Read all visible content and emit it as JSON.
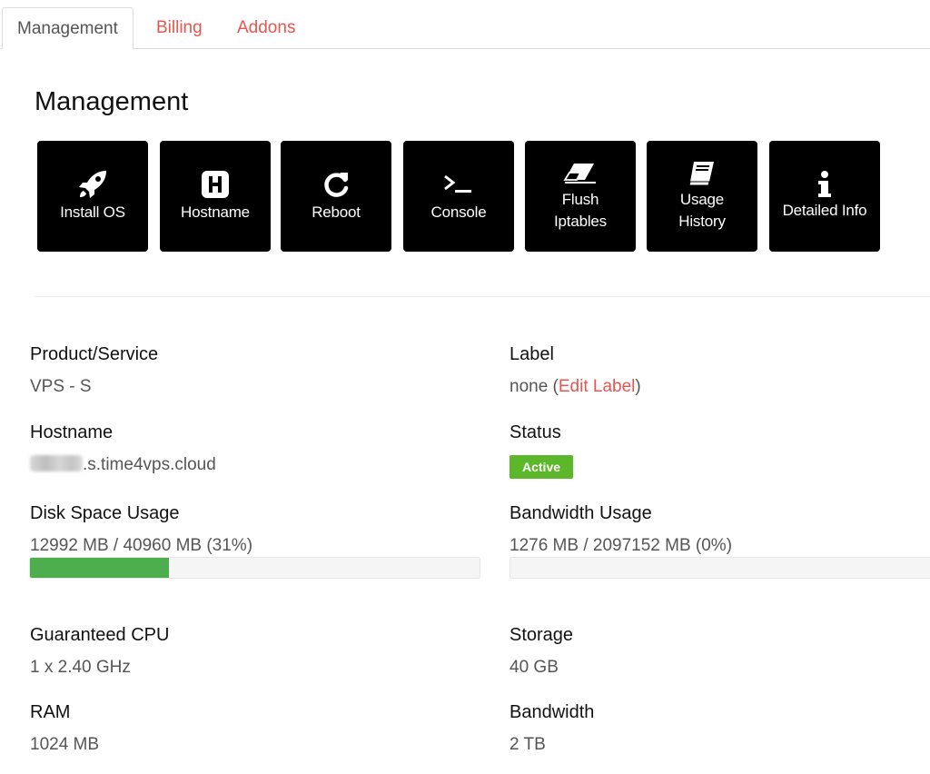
{
  "tabs": [
    {
      "label": "Management",
      "active": true
    },
    {
      "label": "Billing",
      "active": false
    },
    {
      "label": "Addons",
      "active": false
    }
  ],
  "management": {
    "title": "Management",
    "actions": [
      {
        "label": "Install OS",
        "icon": "rocket-icon"
      },
      {
        "label": "Hostname",
        "icon": "hostname-h-icon"
      },
      {
        "label": "Reboot",
        "icon": "reboot-icon"
      },
      {
        "label": "Console",
        "icon": "terminal-icon"
      },
      {
        "label": "Flush Iptables",
        "icon": "eraser-icon"
      },
      {
        "label": "Usage History",
        "icon": "book-icon"
      },
      {
        "label": "Detailed Info",
        "icon": "info-icon"
      }
    ]
  },
  "details": {
    "product": {
      "label": "Product/Service",
      "value": "VPS - S"
    },
    "label_field": {
      "label": "Label",
      "value_prefix": "none (",
      "edit_link": "Edit Label",
      "value_suffix": ")"
    },
    "hostname": {
      "label": "Hostname",
      "value": ".s.time4vps.cloud"
    },
    "status": {
      "label": "Status",
      "value": "Active",
      "color": "#5cb82a"
    },
    "disk": {
      "label": "Disk Space Usage",
      "value": "12992 MB / 40960 MB (31%)",
      "percent": 31
    },
    "bandwidth_usage": {
      "label": "Bandwidth Usage",
      "value": "1276 MB / 2097152 MB (0%)",
      "percent": 0
    },
    "cpu": {
      "label": "Guaranteed CPU",
      "value": "1 x 2.40 GHz"
    },
    "storage": {
      "label": "Storage",
      "value": "40 GB"
    },
    "ram": {
      "label": "RAM",
      "value": "1024 MB"
    },
    "bandwidth": {
      "label": "Bandwidth",
      "value": "2 TB"
    }
  },
  "colors": {
    "accent": "#e8554e",
    "progress": "#4cae4c",
    "button_bg": "#000000"
  }
}
